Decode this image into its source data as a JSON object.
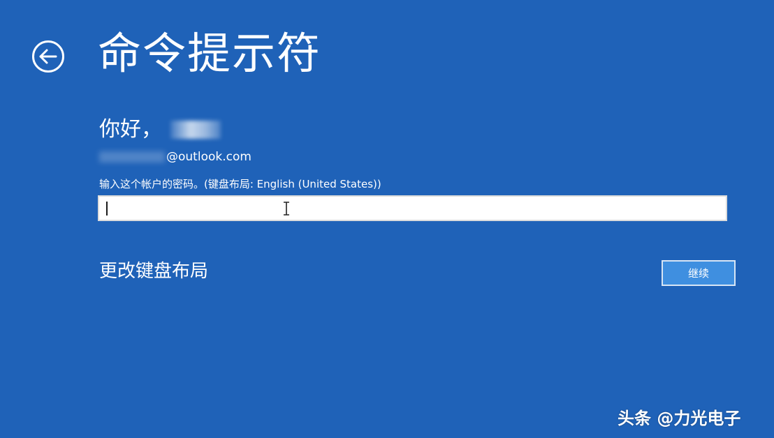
{
  "header": {
    "title": "命令提示符",
    "back_icon": "back-arrow-icon"
  },
  "account": {
    "greeting": "你好，",
    "email_domain": "@outlook.com"
  },
  "password": {
    "prompt": "输入这个帐户的密码。(键盘布局: English (United States))",
    "value": ""
  },
  "actions": {
    "change_layout_label": "更改键盘布局",
    "continue_label": "继续"
  },
  "watermark": {
    "text": "头条 @力光电子"
  },
  "colors": {
    "background": "#1f62b8",
    "button": "#3f8fe0"
  }
}
